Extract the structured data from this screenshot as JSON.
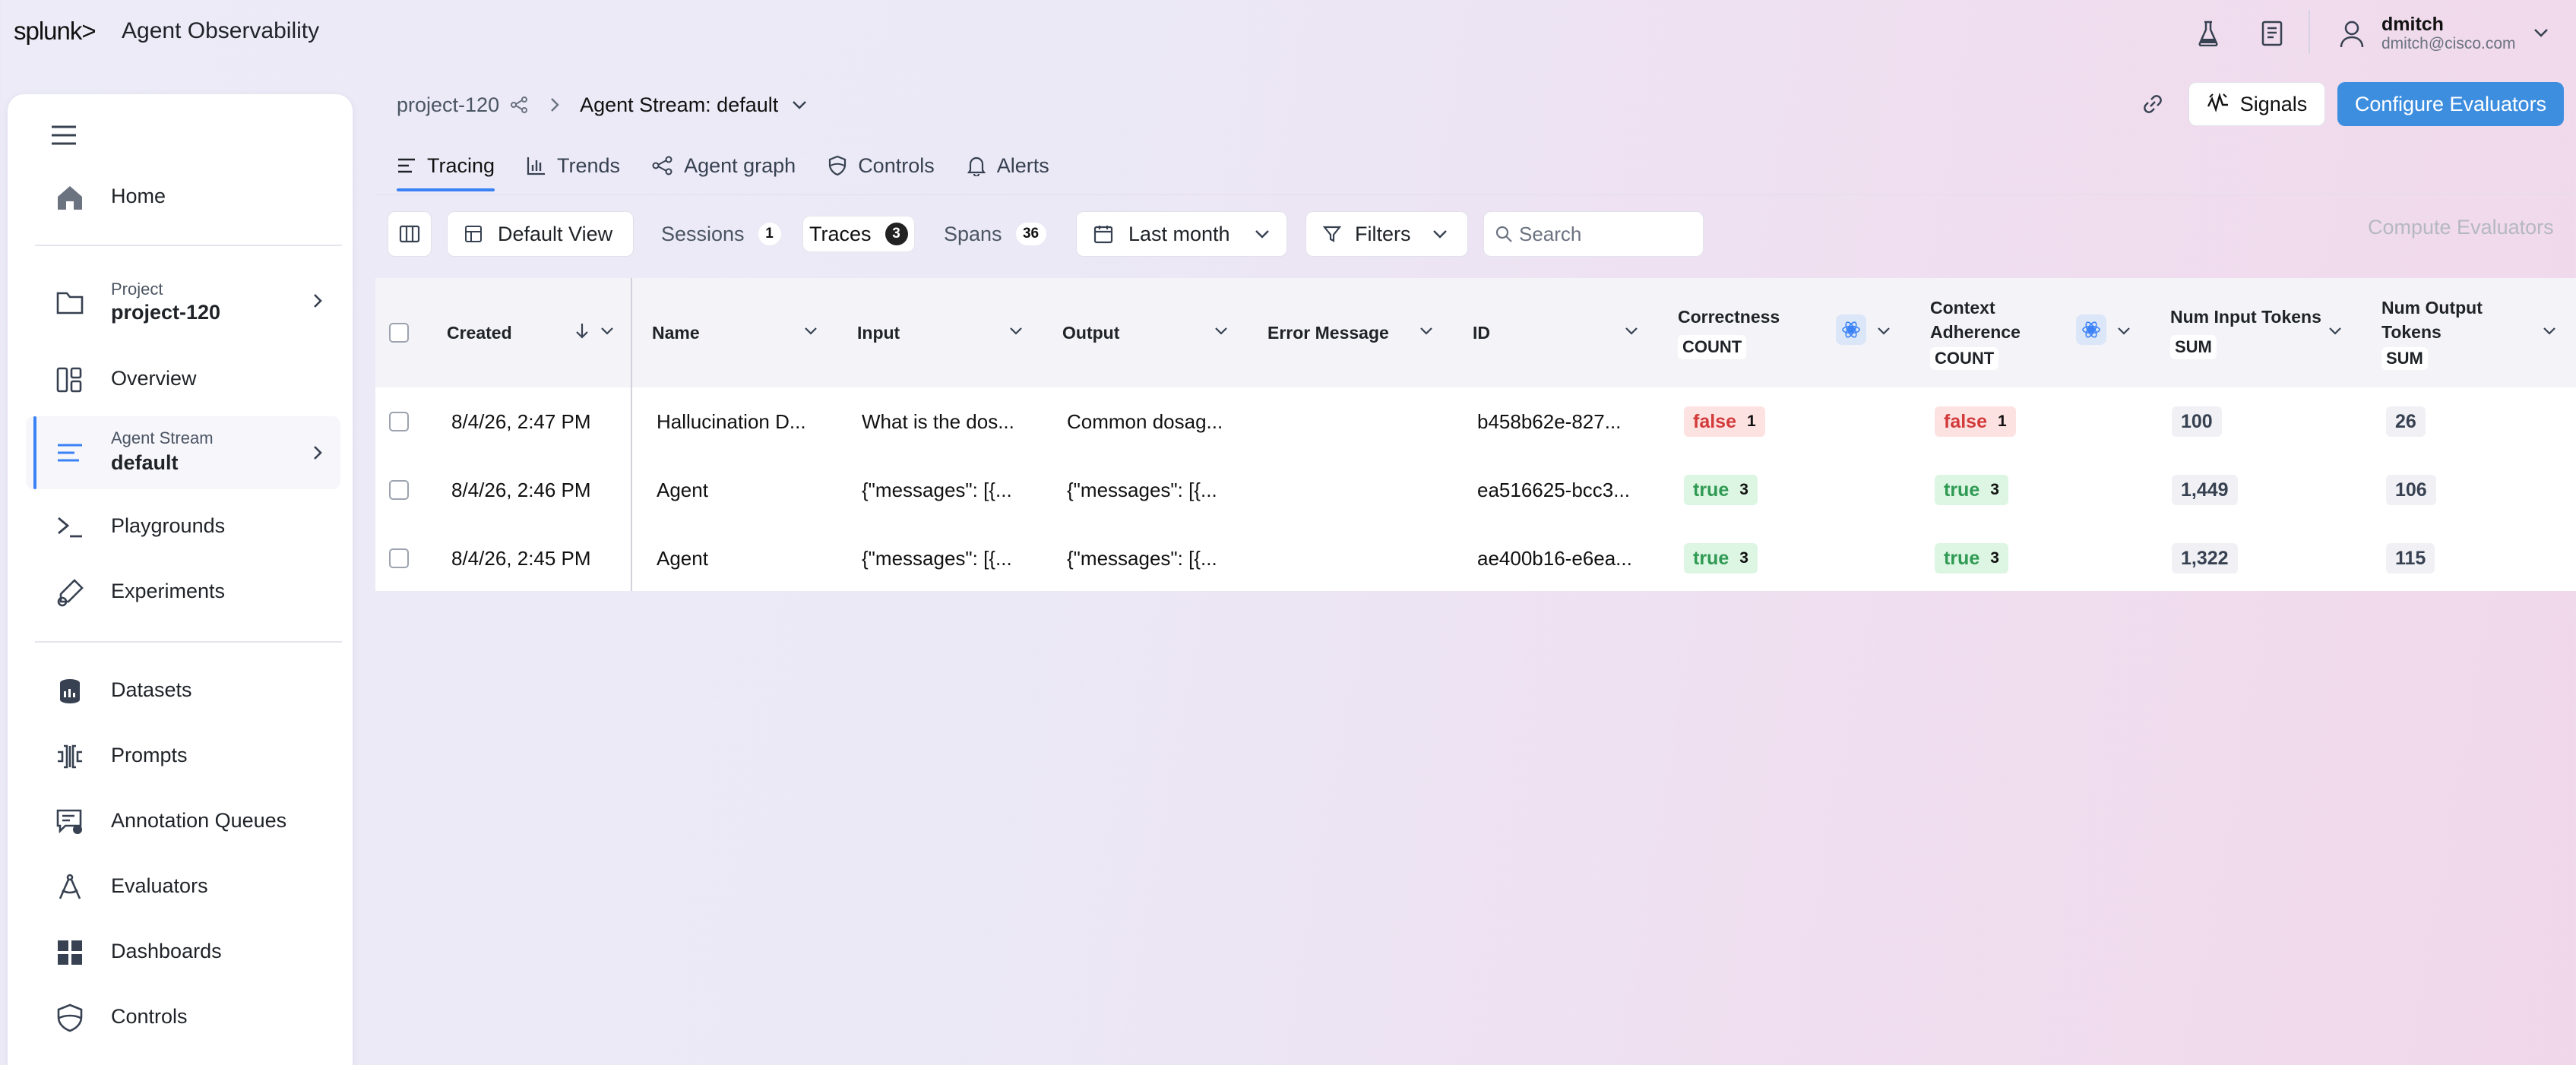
{
  "app": {
    "brand": "splunk>",
    "title": "Agent Observability"
  },
  "user": {
    "name": "dmitch",
    "email": "dmitch@cisco.com"
  },
  "sidebar": {
    "home": "Home",
    "project": {
      "caption": "Project",
      "name": "project-120"
    },
    "overview": "Overview",
    "stream": {
      "caption": "Agent Stream",
      "name": "default"
    },
    "playgrounds": "Playgrounds",
    "experiments": "Experiments",
    "datasets": "Datasets",
    "prompts": "Prompts",
    "annotation_queues": "Annotation Queues",
    "evaluators": "Evaluators",
    "dashboards": "Dashboards",
    "controls": "Controls"
  },
  "breadcrumb": {
    "project": "project-120",
    "stream": "Agent Stream: default"
  },
  "actions": {
    "signals": "Signals",
    "configure": "Configure Evaluators",
    "compute": "Compute Evaluators"
  },
  "tabs": [
    "Tracing",
    "Trends",
    "Agent graph",
    "Controls",
    "Alerts"
  ],
  "toolbar": {
    "view": "Default View",
    "sessions": {
      "label": "Sessions",
      "count": "1"
    },
    "traces": {
      "label": "Traces",
      "count": "3"
    },
    "spans": {
      "label": "Spans",
      "count": "36"
    },
    "range": "Last month",
    "filters": "Filters",
    "search_placeholder": "Search"
  },
  "table": {
    "headers": {
      "created": "Created",
      "name": "Name",
      "input": "Input",
      "output": "Output",
      "error": "Error Message",
      "id": "ID",
      "correctness": "Correctness",
      "correctness_agg": "COUNT",
      "context1": "Context",
      "context2": "Adherence",
      "context_agg": "COUNT",
      "in_tokens": "Num Input Tokens",
      "in_agg": "SUM",
      "out1": "Num Output",
      "out2": "Tokens",
      "out_agg": "SUM"
    },
    "rows": [
      {
        "created": "8/4/26, 2:47 PM",
        "name": "Hallucination D...",
        "input": "What is the dos...",
        "output": "Common dosag...",
        "error": "",
        "id": "b458b62e-827...",
        "correctness": "false",
        "correctness_n": "1",
        "context": "false",
        "context_n": "1",
        "in_tokens": "100",
        "out_tokens": "26"
      },
      {
        "created": "8/4/26, 2:46 PM",
        "name": "Agent",
        "input": "{\"messages\": [{...",
        "output": "{\"messages\": [{...",
        "error": "",
        "id": "ea516625-bcc3...",
        "correctness": "true",
        "correctness_n": "3",
        "context": "true",
        "context_n": "3",
        "in_tokens": "1,449",
        "out_tokens": "106"
      },
      {
        "created": "8/4/26, 2:45 PM",
        "name": "Agent",
        "input": "{\"messages\": [{...",
        "output": "{\"messages\": [{...",
        "error": "",
        "id": "ae400b16-e6ea...",
        "correctness": "true",
        "correctness_n": "3",
        "context": "true",
        "context_n": "3",
        "in_tokens": "1,322",
        "out_tokens": "115"
      }
    ]
  },
  "icons": [
    "flask-icon",
    "book-icon",
    "user-icon",
    "link-icon",
    "signals-icon",
    "gear-eval-icon"
  ]
}
